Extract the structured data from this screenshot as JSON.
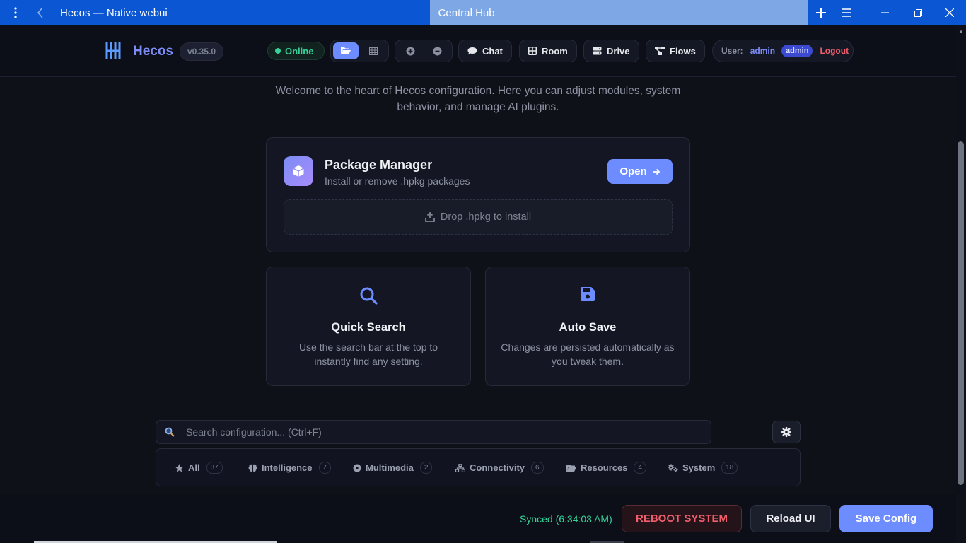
{
  "titlebar": {
    "title": "Hecos — Native webui",
    "tab2": "Central Hub"
  },
  "header": {
    "brand": "Hecos",
    "version": "v0.35.0",
    "status": "Online",
    "nav": {
      "chat": "Chat",
      "room": "Room",
      "drive": "Drive",
      "flows": "Flows"
    },
    "user": {
      "label": "User:",
      "name": "admin",
      "role": "admin",
      "logout": "Logout"
    }
  },
  "main": {
    "welcome": "Welcome to the heart of Hecos configuration. Here you can adjust modules, system behavior, and manage AI plugins.",
    "package": {
      "title": "Package Manager",
      "subtitle": "Install or remove .hpkg packages",
      "open": "Open",
      "drop": "Drop .hpkg to install"
    },
    "features": [
      {
        "title": "Quick Search",
        "desc": "Use the search bar at the top to instantly find any setting."
      },
      {
        "title": "Auto Save",
        "desc": "Changes are persisted automatically as you tweak them."
      }
    ],
    "search": {
      "placeholder": "Search configuration... (Ctrl+F)"
    },
    "categories": [
      {
        "label": "All",
        "count": "37"
      },
      {
        "label": "Intelligence",
        "count": "7"
      },
      {
        "label": "Multimedia",
        "count": "2"
      },
      {
        "label": "Connectivity",
        "count": "6"
      },
      {
        "label": "Resources",
        "count": "4"
      },
      {
        "label": "System",
        "count": "18"
      }
    ]
  },
  "footer": {
    "synced": "Synced (6:34:03 AM)",
    "reboot": "REBOOT SYSTEM",
    "reload": "Reload UI",
    "save": "Save Config"
  },
  "colors": {
    "accent": "#6d8cff",
    "brand": "#7c8cf6",
    "success": "#34d399",
    "danger": "#f05d6c",
    "titlebar": "#0a56d3"
  }
}
